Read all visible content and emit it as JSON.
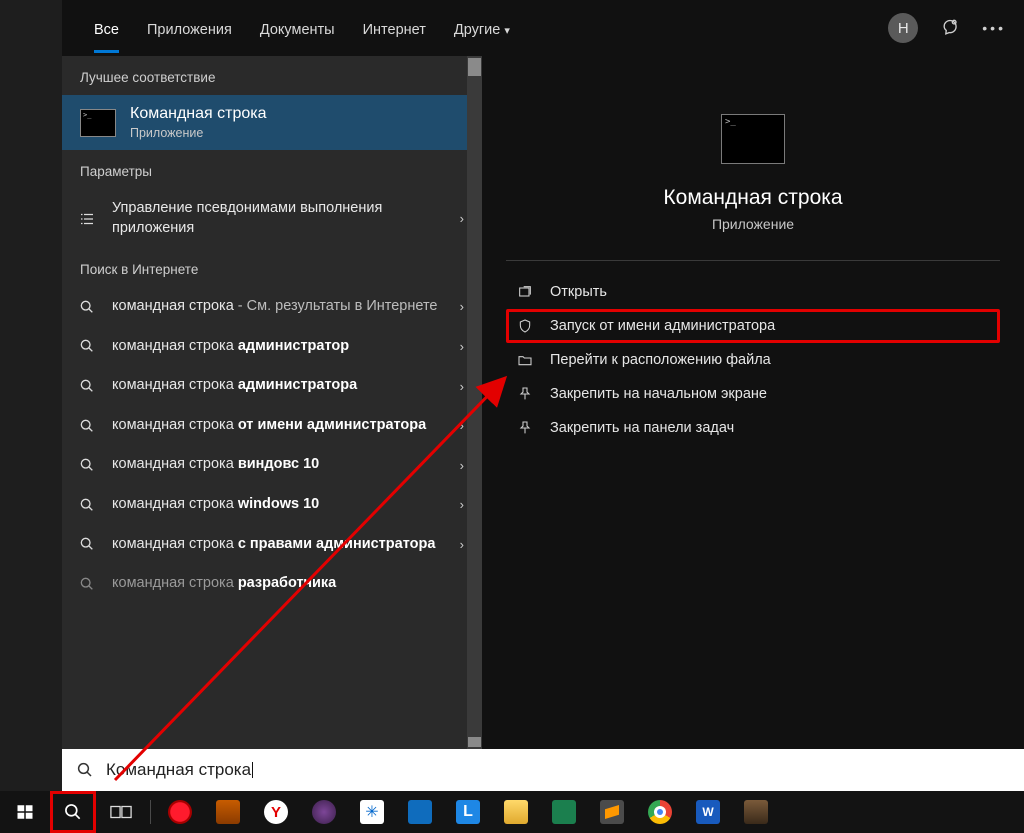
{
  "top": {
    "tabs": [
      "Все",
      "Приложения",
      "Документы",
      "Интернет",
      "Другие"
    ],
    "user_initial": "Н"
  },
  "left": {
    "best_match_header": "Лучшее соответствие",
    "best_match": {
      "title": "Командная строка",
      "subtitle": "Приложение"
    },
    "settings_header": "Параметры",
    "settings_item": "Управление псевдонимами выполнения приложения",
    "web_header": "Поиск в Интернете",
    "web_items": [
      {
        "prefix": "командная строка",
        "bold": "",
        "suffix": " - См. результаты в Интернете"
      },
      {
        "prefix": "командная строка ",
        "bold": "администратор",
        "suffix": ""
      },
      {
        "prefix": "командная строка ",
        "bold": "администратора",
        "suffix": ""
      },
      {
        "prefix": "командная строка ",
        "bold": "от имени администратора",
        "suffix": ""
      },
      {
        "prefix": "командная строка ",
        "bold": "виндовс 10",
        "suffix": ""
      },
      {
        "prefix": "командная строка ",
        "bold": "windows 10",
        "suffix": ""
      },
      {
        "prefix": "командная строка ",
        "bold": "с правами администратора",
        "suffix": ""
      }
    ],
    "web_cutoff": {
      "prefix": "командная строка ",
      "bold": "разработчика"
    }
  },
  "right": {
    "title": "Командная строка",
    "subtitle": "Приложение",
    "actions": [
      {
        "id": "open",
        "label": "Открыть"
      },
      {
        "id": "run-admin",
        "label": "Запуск от имени администратора",
        "highlight": true
      },
      {
        "id": "open-loc",
        "label": "Перейти к расположению файла"
      },
      {
        "id": "pin-start",
        "label": "Закрепить на начальном экране"
      },
      {
        "id": "pin-taskbar",
        "label": "Закрепить на панели задач"
      }
    ]
  },
  "search_input": "Командная строка",
  "taskbar_apps": [
    "task-view",
    "opera",
    "folder-orange",
    "yandex",
    "tor",
    "asterisk",
    "mail",
    "l-app",
    "explorer",
    "green-app",
    "sublime",
    "chrome",
    "word",
    "wood-app"
  ],
  "colors": {
    "accent": "#0078d6",
    "highlight": "#e30000",
    "selected_row": "#1f4c6d"
  }
}
